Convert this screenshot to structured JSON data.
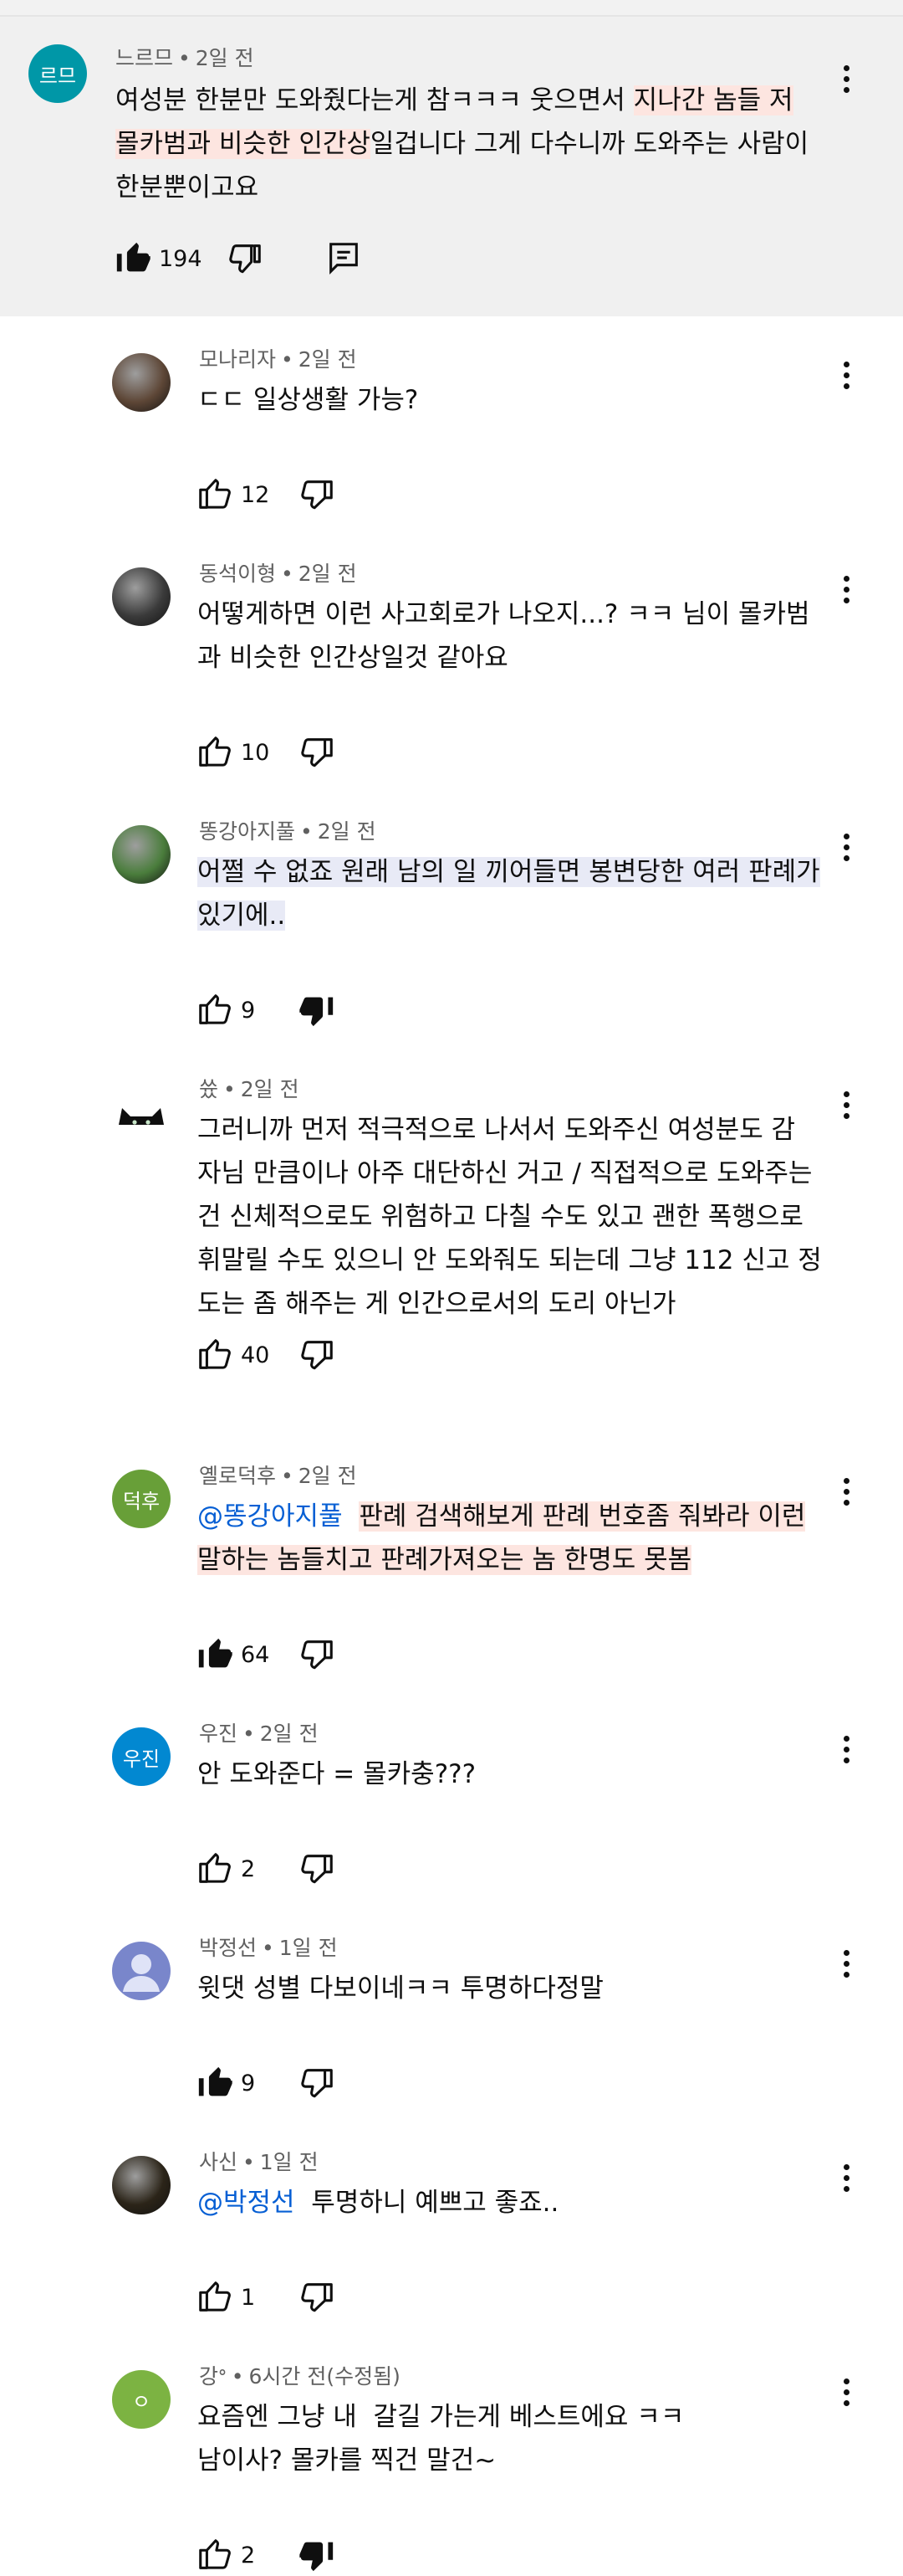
{
  "parent": {
    "avatar_text": "르므",
    "avatar_color": "#0097a7",
    "author": "느르므",
    "time": "2일 전",
    "text_pre": "여성분 한분만 도와줬다는게 참ㅋㅋㅋ 웃으면서 ",
    "text_hl1": "지나간 놈들 저",
    "text_mid": "\n",
    "text_hl2": "몰카범과 비슷한 인간상",
    "text_post": "일겁니다 그게 다수니까 도와주는 사람이\n한분뿐이고요",
    "likes": "194",
    "liked": true,
    "reply_icon": "reply-icon"
  },
  "replies": [
    {
      "author": "모나리자",
      "time": "2일 전",
      "avatar": "photo",
      "avatar_color": "#5d4636",
      "text": "ㄷㄷ 일상생활 가능?",
      "likes": "12",
      "liked": false,
      "disliked": false
    },
    {
      "author": "동석이형",
      "time": "2일 전",
      "avatar": "photo",
      "avatar_color": "#3a3a3a",
      "text": "어떻게하면 이런 사고회로가 나오지...? ㅋㅋ 님이 몰카범\n과 비슷한 인간상일것 같아요",
      "likes": "10",
      "liked": false,
      "disliked": false
    },
    {
      "author": "똥강아지풀",
      "time": "2일 전",
      "avatar": "photo",
      "avatar_color": "#4a7d3c",
      "text": "어쩔 수 없죠 원래 남의 일 끼어들면 봉변당한 여러 판례가\n있기에..",
      "likes": "9",
      "liked": false,
      "disliked": true
    },
    {
      "author": "쓨",
      "time": "2일 전",
      "avatar": "cat",
      "avatar_color": "#ffffff",
      "text": "그러니까 먼저 적극적으로 나서서 도와주신 여성분도 감\n자님 만큼이나 아주 대단하신 거고 / 직접적으로 도와주는\n건 신체적으로도 위험하고 다칠 수도 있고 괜한 폭행으로\n휘말릴 수도 있으니 안 도와줘도 되는데 그냥 112 신고 정\n도는 좀 해주는 게 인간으로서의 도리 아닌가",
      "likes": "40",
      "liked": false,
      "disliked": false
    },
    {
      "author": "옐로덕후",
      "time": "2일 전",
      "avatar": "text",
      "avatar_text": "덕후",
      "avatar_color": "#689f38",
      "mention": "@똥강아지풀",
      "text": "판례 검색해보게 판례 번호좀 줘봐라 이런\n말하는 놈들치고 판례가져오는 놈 한명도 못봄",
      "likes": "64",
      "liked": true,
      "disliked": false
    },
    {
      "author": "우진",
      "time": "2일 전",
      "avatar": "text",
      "avatar_text": "우진",
      "avatar_color": "#0288d1",
      "text": "안 도와준다 = 몰카충???",
      "likes": "2",
      "liked": false,
      "disliked": false
    },
    {
      "author": "박정선",
      "time": "1일 전",
      "avatar": "default",
      "avatar_color": "#7986cb",
      "text": "윗댓 성별 다보이네ㅋㅋ 투명하다정말",
      "likes": "9",
      "liked": true,
      "disliked": false
    },
    {
      "author": "사신",
      "time": "1일 전",
      "avatar": "photo",
      "avatar_color": "#2b2418",
      "mention": "@박정선",
      "text": "투명하니 예쁘고 좋죠..",
      "likes": "1",
      "liked": false,
      "disliked": false
    },
    {
      "author": "강ᐤ",
      "time": "6시간 전(수정됨)",
      "avatar": "text",
      "avatar_text": "ㅇ",
      "avatar_color": "#7cb342",
      "text": "요즘엔 그냥 내  갈길 가는게 베스트에요 ㅋㅋ\n남이사? 몰카를 찍건 말건~",
      "likes": "2",
      "liked": false,
      "disliked": true
    }
  ],
  "icons": {
    "like": "thumbs-up-icon",
    "dislike": "thumbs-down-icon",
    "more": "more-vert-icon"
  }
}
